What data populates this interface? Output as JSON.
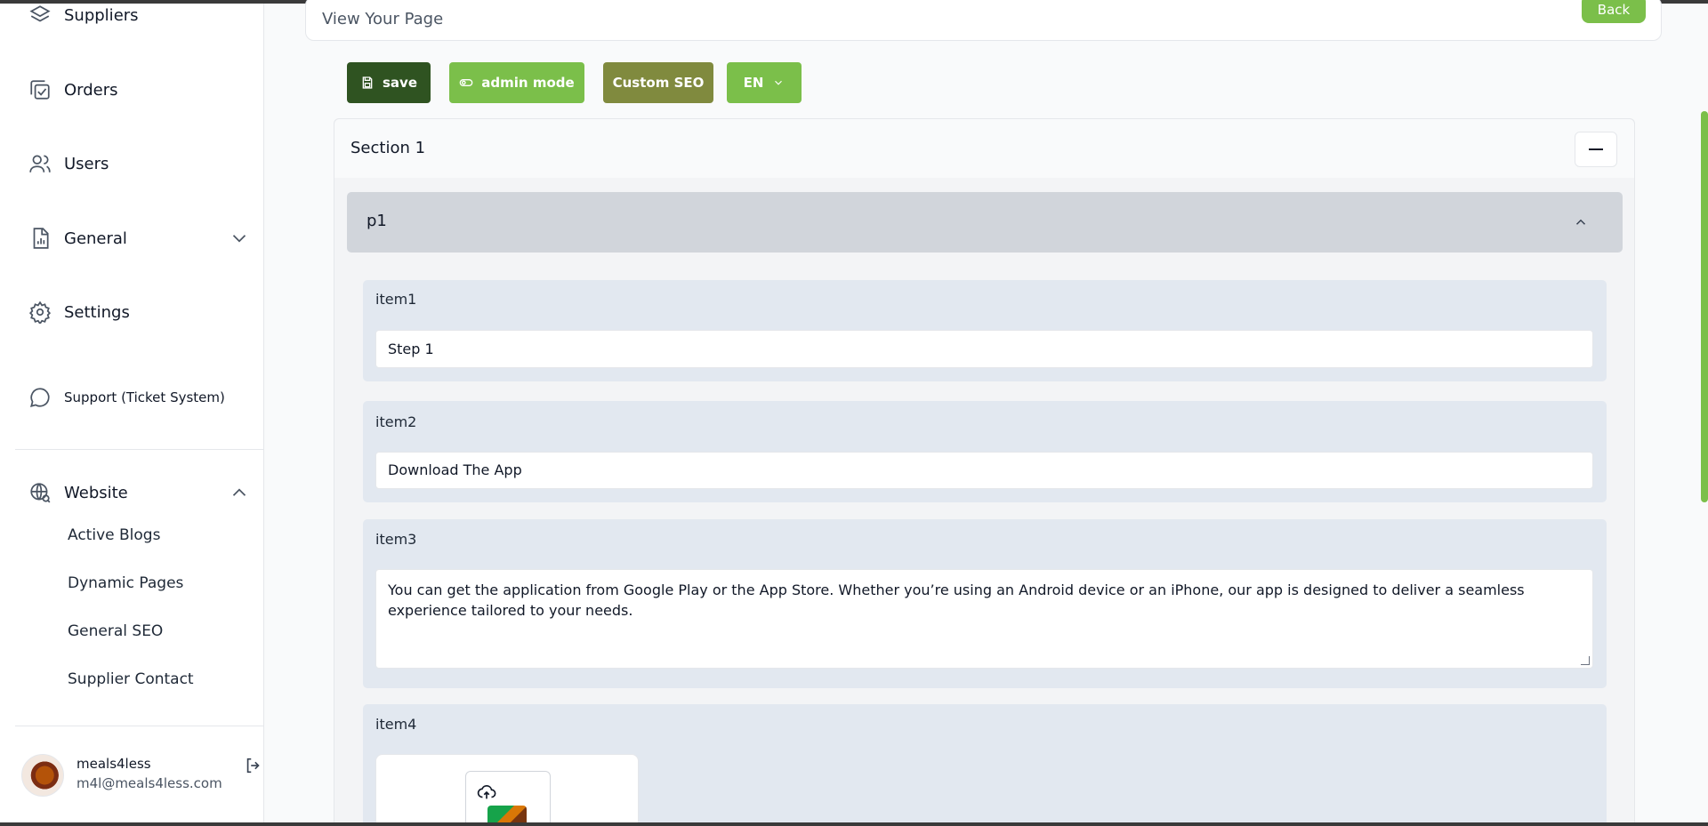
{
  "sidebar": {
    "items": [
      {
        "label": "Suppliers",
        "icon": "layers-icon"
      },
      {
        "label": "Orders",
        "icon": "orders-icon"
      },
      {
        "label": "Users",
        "icon": "users-icon"
      },
      {
        "label": "General",
        "icon": "report-icon"
      },
      {
        "label": "Settings",
        "icon": "gear-icon"
      },
      {
        "label": "Support (Ticket System)",
        "icon": "chat-icon"
      },
      {
        "label": "Website",
        "icon": "globe-search-icon"
      }
    ],
    "website_subitems": [
      "Active Blogs",
      "Dynamic Pages",
      "General SEO",
      "Supplier Contact"
    ],
    "user": {
      "name": "meals4less",
      "email": "m4l@meals4less.com"
    }
  },
  "header": {
    "title": "View Your Page",
    "back_label": "Back"
  },
  "toolbar": {
    "save_label": "save",
    "admin_label": "admin mode",
    "seo_label": "Custom SEO",
    "lang_label": "EN"
  },
  "section": {
    "title": "Section 1",
    "panel_title": "p1",
    "items": [
      {
        "label": "item1",
        "value": "Step 1"
      },
      {
        "label": "item2",
        "value": "Download The App"
      },
      {
        "label": "item3",
        "value": "You can get the application from Google Play or the App Store. Whether you’re using an Android device or an iPhone, our app is designed to deliver a seamless experience tailored to your needs."
      },
      {
        "label": "item4"
      }
    ]
  },
  "colors": {
    "accent_green": "#7bbf4a",
    "dark_green": "#2f5321",
    "olive": "#808a3e"
  }
}
